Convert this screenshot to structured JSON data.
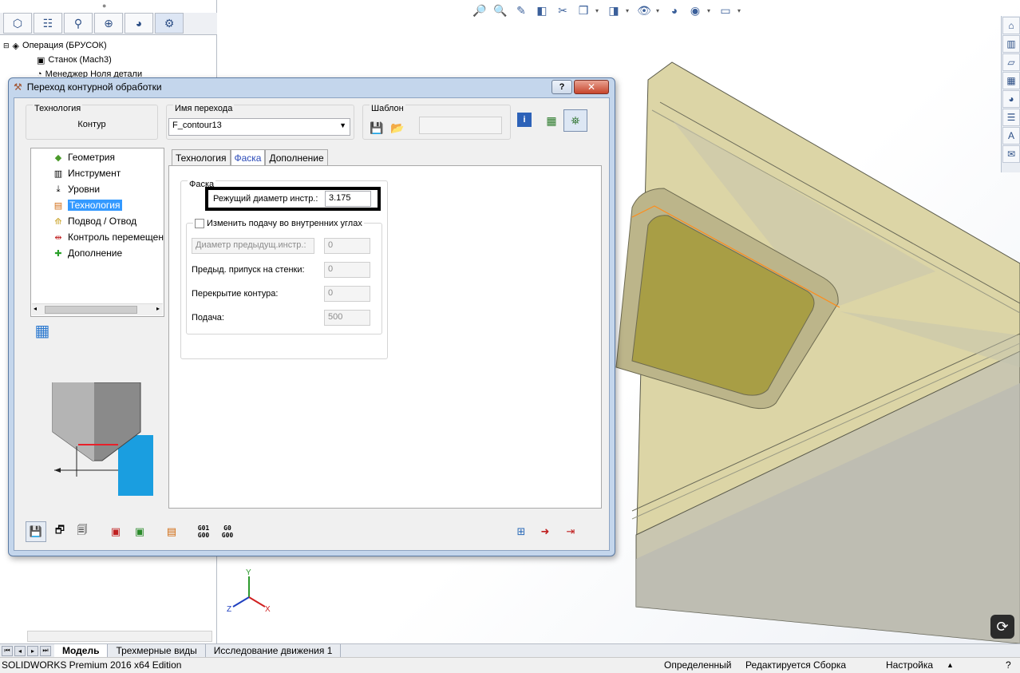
{
  "app": {
    "status_product": "SOLIDWORKS Premium 2016 x64 Edition",
    "status_state": "Определенный",
    "status_edit": "Редактируется Сборка",
    "status_settings": "Настройка"
  },
  "bottom_tabs": [
    "Модель",
    "Трехмерные виды",
    "Исследование движения 1"
  ],
  "feature_tree": {
    "items": [
      "Операция (БРУСОК)",
      "Станок (Mach3)",
      "Менеджер Ноля детали"
    ]
  },
  "dialog": {
    "title": "Переход контурной обработки",
    "help_label": "?",
    "close_label": "✕",
    "technology": {
      "label": "Технология",
      "value": "Контур"
    },
    "step_name": {
      "label": "Имя перехода",
      "value": "F_contour13"
    },
    "template": {
      "label": "Шаблон",
      "value": ""
    },
    "tree": {
      "items": [
        "Геометрия",
        "Инструмент",
        "Уровни",
        "Технология",
        "Подвод / Отвод",
        "Контроль перемещен",
        "Дополнение"
      ],
      "selected": "Технология"
    },
    "tabs": [
      "Технология",
      "Фаска",
      "Дополнение"
    ],
    "active_tab": "Фаска",
    "chamfer": {
      "group_label": "Фаска",
      "cutting_diameter_label": "Режущий диаметр инстр.:",
      "cutting_diameter_value": "3.175",
      "inner_corner_checkbox_label": "Изменить подачу во внутренних углах",
      "prev_diameter_label": "Диаметр предыдущ.инстр.:",
      "prev_diameter_value": "0",
      "wall_allowance_label": "Предыд. припуск на стенки:",
      "wall_allowance_value": "0",
      "contour_overlap_label": "Перекрытие контура:",
      "contour_overlap_value": "0",
      "feed_label": "Подача:",
      "feed_value": "500"
    },
    "gcode_buttons": [
      {
        "line1": "G01",
        "line2": "G00"
      },
      {
        "line1": "G0",
        "line2": "G00"
      }
    ]
  },
  "axes": {
    "x": "X",
    "y": "Y",
    "z": "Z"
  },
  "colors": {
    "dialog_frame": "#c4d6ec",
    "selection": "#3399ff",
    "part_body": "#d8d2a4",
    "pocket_floor": "#a59a3e",
    "toolpath": "#ff8c1a",
    "tool_highlight": "#e8202a"
  }
}
